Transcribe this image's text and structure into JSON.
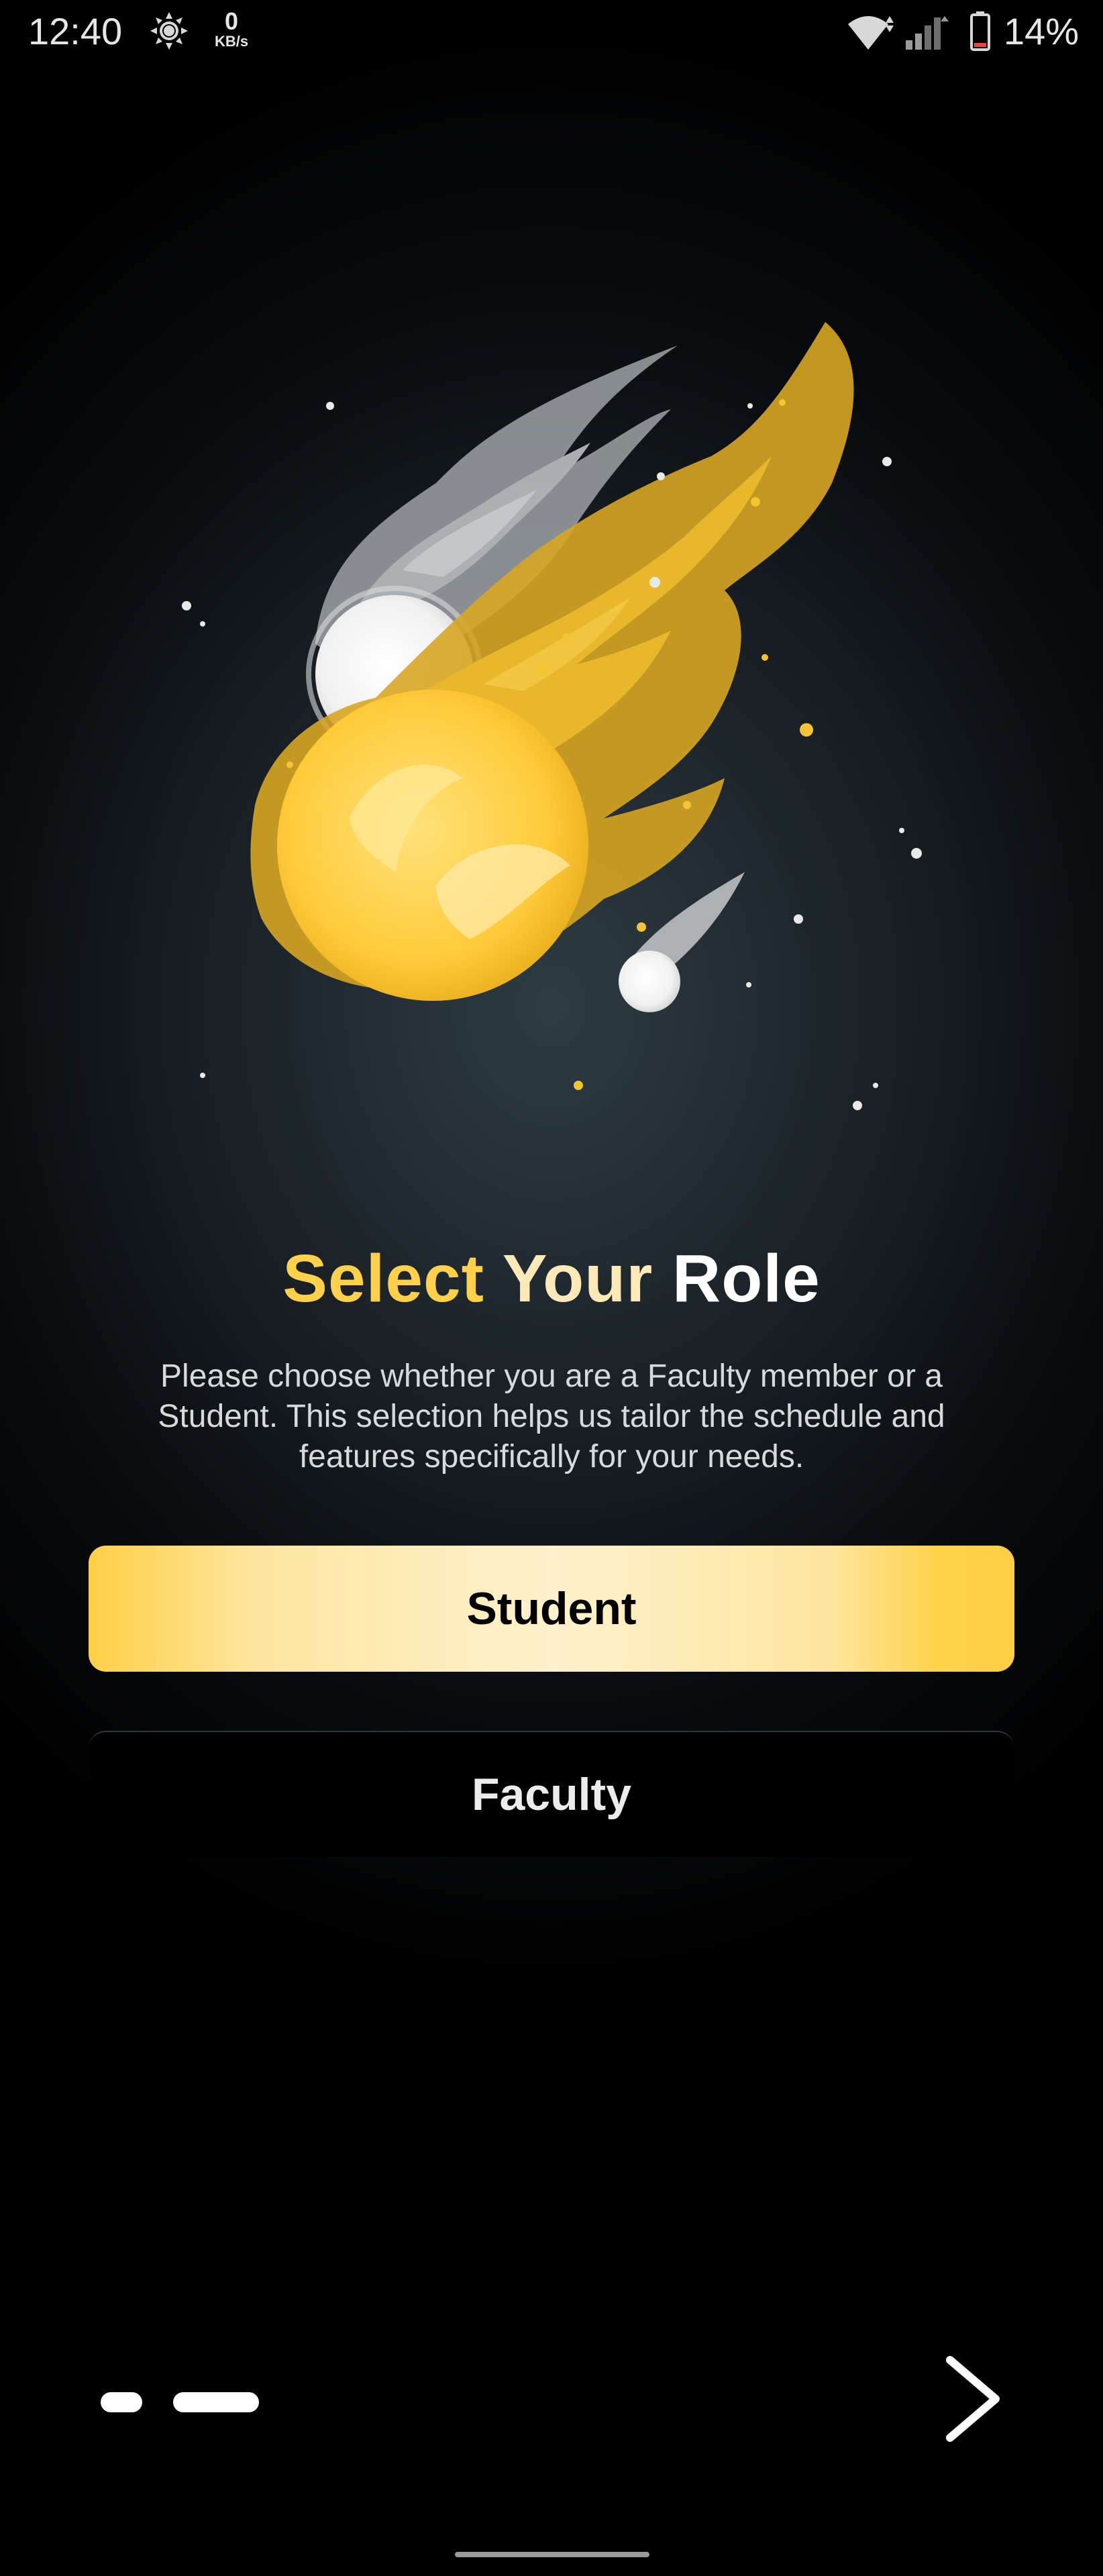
{
  "status_bar": {
    "time": "12:40",
    "network_speed_value": "0",
    "network_speed_unit": "KB/s",
    "battery_percent": "14%"
  },
  "onboarding": {
    "title_words": [
      "Select",
      "Your",
      "Role"
    ],
    "description": "Please choose whether you are a Faculty member or a Student. This selection helps us tailor the schedule and features specifically for your needs.",
    "roles": {
      "student_label": "Student",
      "faculty_label": "Faculty"
    }
  },
  "pagination": {
    "current_page": 2,
    "total_pages": 2
  },
  "colors": {
    "accent_yellow": "#ffd04a",
    "background": "#000000",
    "student_button": "#fde6a0"
  },
  "icons": {
    "next": "chevron-right-icon",
    "brightness": "brightness-icon",
    "wifi": "wifi-icon",
    "signal": "signal-icon",
    "battery": "battery-icon"
  }
}
